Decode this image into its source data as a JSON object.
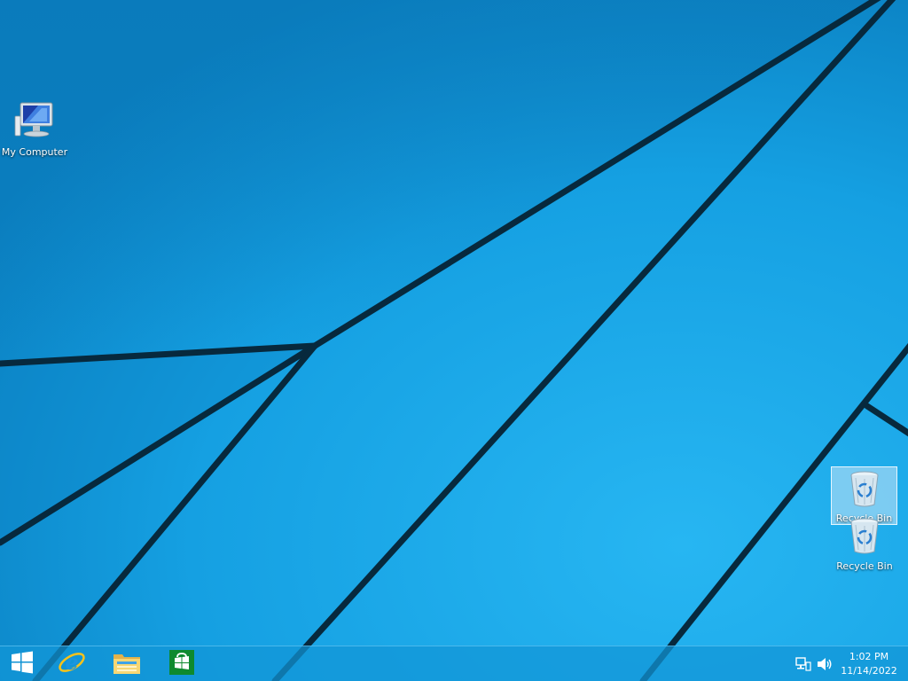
{
  "desktop": {
    "background_color": "#1aa4e6",
    "icons": [
      {
        "label": "My Computer",
        "icon": "computer-icon"
      },
      {
        "label": "Recycle Bin",
        "icon": "recycle-bin-icon",
        "selected": true
      },
      {
        "label": "Recycle Bin",
        "icon": "recycle-bin-icon",
        "selected": false
      }
    ]
  },
  "taskbar": {
    "pinned": [
      {
        "name": "Start",
        "icon": "windows-logo-icon"
      },
      {
        "name": "Internet Explorer",
        "icon": "internet-explorer-icon"
      },
      {
        "name": "File Explorer",
        "icon": "file-explorer-icon"
      },
      {
        "name": "Store",
        "icon": "store-icon"
      }
    ],
    "tray": {
      "icons": [
        "network-icon",
        "volume-icon"
      ],
      "time": "1:02 PM",
      "date": "11/14/2022"
    }
  }
}
